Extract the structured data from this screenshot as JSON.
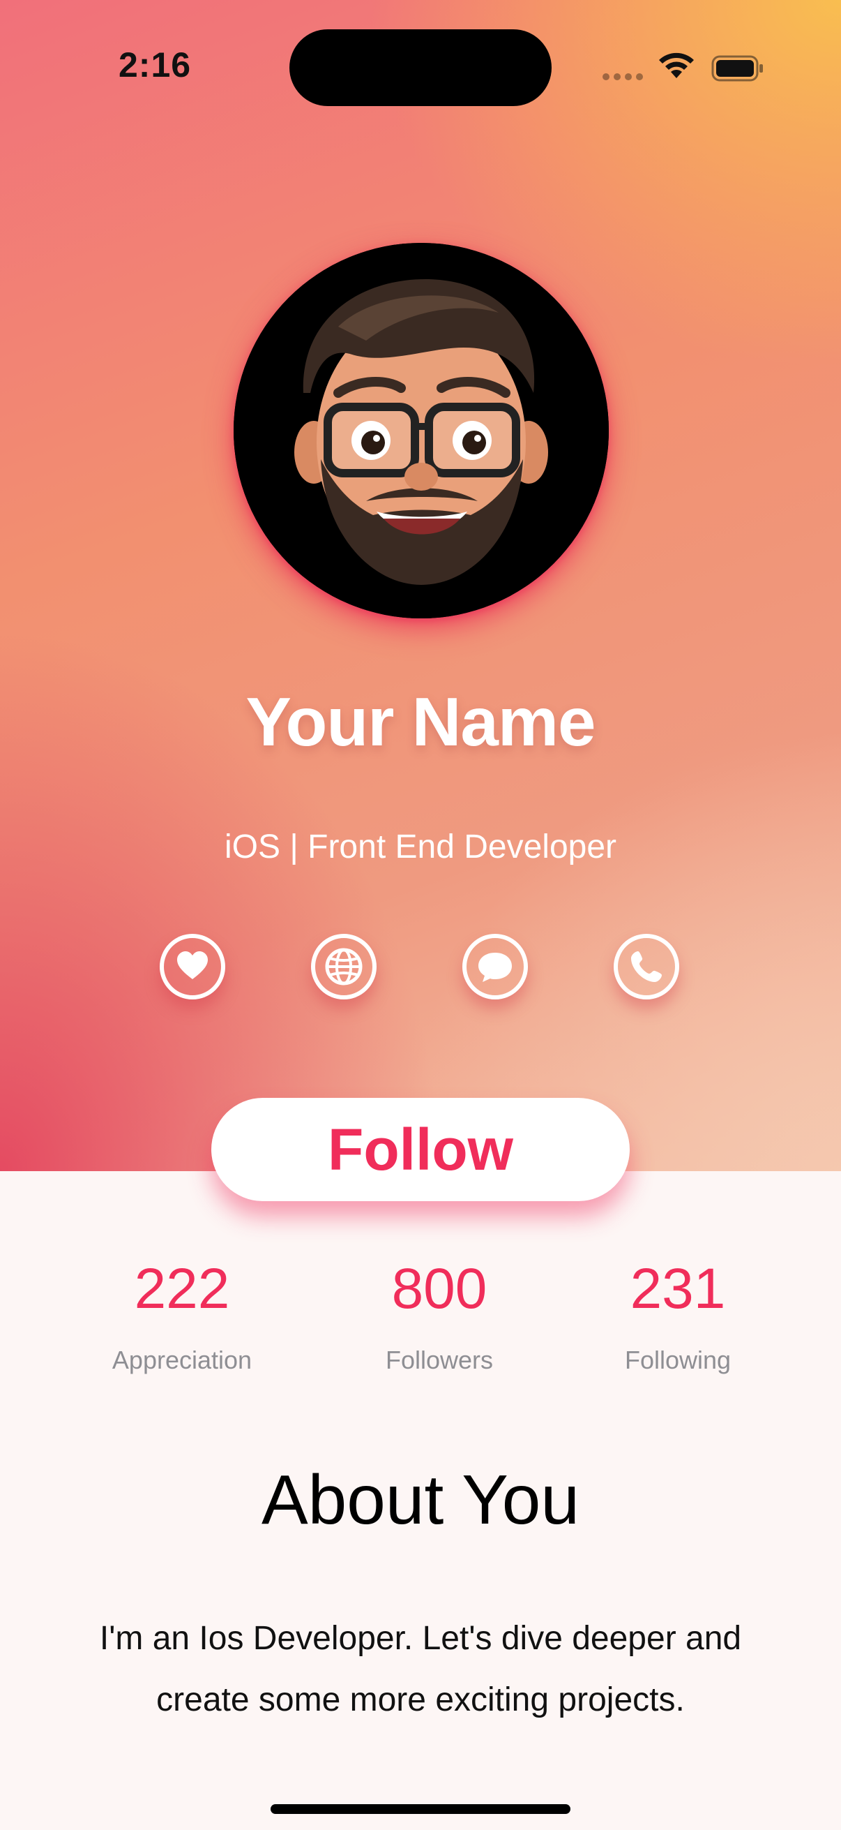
{
  "status_bar": {
    "time": "2:16"
  },
  "profile": {
    "name": "Your Name",
    "title": "iOS | Front End Developer",
    "avatar_icon": "memoji-avatar"
  },
  "social_icons": [
    {
      "name": "heart-icon"
    },
    {
      "name": "globe-icon"
    },
    {
      "name": "message-icon"
    },
    {
      "name": "phone-icon"
    }
  ],
  "follow_button": {
    "label": "Follow"
  },
  "stats": [
    {
      "value": "222",
      "label": "Appreciation"
    },
    {
      "value": "800",
      "label": "Followers"
    },
    {
      "value": "231",
      "label": "Following"
    }
  ],
  "about": {
    "title": "About You",
    "text": "I'm an Ios Developer. Let's dive deeper and create some more exciting projects."
  },
  "colors": {
    "accent": "#f02d5a",
    "background": "#fdf6f5"
  }
}
